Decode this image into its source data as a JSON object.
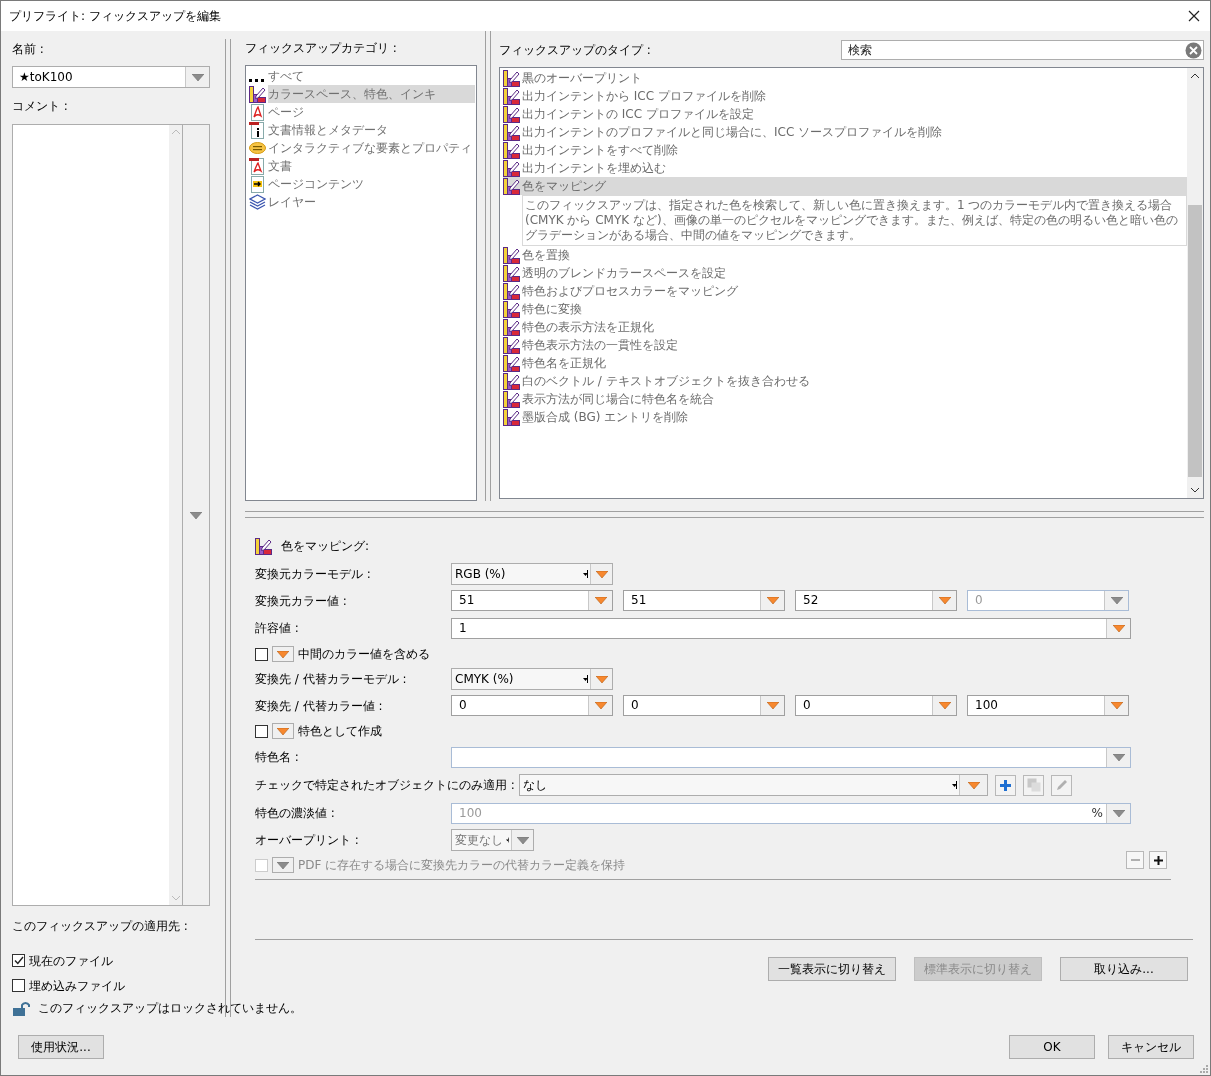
{
  "window": {
    "title": "プリフライト: フィックスアップを編集"
  },
  "name_field": {
    "label": "名前 :",
    "value": "★toK100"
  },
  "comment": {
    "label": "コメント :"
  },
  "apply_to": {
    "label": "このフィックスアップの適用先 :",
    "options": [
      {
        "label": "現在のファイル",
        "checked": true
      },
      {
        "label": "埋め込みファイル",
        "checked": false
      }
    ]
  },
  "lock_status": {
    "locked": false,
    "text": "このフィックスアップはロックされていません。"
  },
  "categories": {
    "label": "フィックスアップカテゴリ :",
    "items": [
      {
        "label": "すべて",
        "kind": "dots",
        "selected": false
      },
      {
        "label": "カラースペース、特色、インキ",
        "kind": "swatch",
        "selected": true
      },
      {
        "label": "ページ",
        "kind": "pdf",
        "selected": false
      },
      {
        "label": "文書情報とメタデータ",
        "kind": "info",
        "selected": false
      },
      {
        "label": "インタラクティブな要素とプロパティ",
        "kind": "comment",
        "selected": false
      },
      {
        "label": "文書",
        "kind": "doc",
        "selected": false
      },
      {
        "label": "ページコンテンツ",
        "kind": "content",
        "selected": false
      },
      {
        "label": "レイヤー",
        "kind": "layers",
        "selected": false
      }
    ]
  },
  "types": {
    "label": "フィックスアップのタイプ :",
    "search": {
      "placeholder": "検索"
    },
    "items": [
      {
        "label": "黒のオーバープリント",
        "selected": false
      },
      {
        "label": "出力インテントから ICC プロファイルを削除",
        "selected": false
      },
      {
        "label": "出力インテントの ICC プロファイルを設定",
        "selected": false
      },
      {
        "label": "出力インテントのプロファイルと同じ場合に、ICC ソースプロファイルを削除",
        "selected": false
      },
      {
        "label": "出力インテントをすべて削除",
        "selected": false
      },
      {
        "label": "出力インテントを埋め込む",
        "selected": false
      },
      {
        "label": "色をマッピング",
        "selected": true,
        "description": "このフィックスアップは、指定された色を検索して、新しい色に置き換えます。1 つのカラーモデル内で置き換える場合 (CMYK から CMYK など)、画像の単一のピクセルをマッピングできます。また、例えば、特定の色の明るい色と暗い色のグラデーションがある場合、中間の値をマッピングできます。"
      },
      {
        "label": "色を置換",
        "selected": false
      },
      {
        "label": "透明のブレンドカラースペースを設定",
        "selected": false
      },
      {
        "label": "特色およびプロセスカラーをマッピング",
        "selected": false
      },
      {
        "label": "特色に変換",
        "selected": false
      },
      {
        "label": "特色の表示方法を正規化",
        "selected": false
      },
      {
        "label": "特色表示方法の一貫性を設定",
        "selected": false
      },
      {
        "label": "特色名を正規化",
        "selected": false
      },
      {
        "label": "白のベクトル / テキストオブジェクトを抜き合わせる",
        "selected": false
      },
      {
        "label": "表示方法が同じ場合に特色名を統合",
        "selected": false
      },
      {
        "label": "墨版合成 (BG) エントリを削除",
        "selected": false
      }
    ]
  },
  "editor": {
    "title": "色をマッピング:",
    "remove_disabled": true,
    "rows": [
      {
        "kind": "select",
        "label": "変換元カラーモデル :",
        "value": "RGB (%)",
        "disabled": false
      },
      {
        "kind": "values",
        "label": "変換元カラー値 :",
        "fields": [
          {
            "value": "51",
            "disabled": false
          },
          {
            "value": "51",
            "disabled": false
          },
          {
            "value": "52",
            "disabled": false
          },
          {
            "value": "0",
            "disabled": true
          }
        ]
      },
      {
        "kind": "text",
        "label": "許容値 :",
        "value": "1",
        "disabled": false
      },
      {
        "kind": "checkbox",
        "label": "中間のカラー値を含める",
        "checked": false,
        "disabled": false
      },
      {
        "kind": "select",
        "label": "変換先 / 代替カラーモデル :",
        "value": "CMYK (%)",
        "disabled": false
      },
      {
        "kind": "values",
        "label": "変換先 / 代替カラー値 :",
        "fields": [
          {
            "value": "0",
            "disabled": false
          },
          {
            "value": "0",
            "disabled": false
          },
          {
            "value": "0",
            "disabled": false
          },
          {
            "value": "100",
            "disabled": false
          }
        ]
      },
      {
        "kind": "checkbox",
        "label": "特色として作成",
        "checked": false,
        "disabled": false
      },
      {
        "kind": "text",
        "label": "特色名 :",
        "disabled": true
      },
      {
        "kind": "select_tools",
        "label": "チェックで特定されたオブジェクトにのみ適用 :",
        "value": "なし",
        "tools": [
          {
            "kind": "add",
            "disabled": false
          },
          {
            "kind": "duplicate",
            "disabled": true
          },
          {
            "kind": "edit",
            "disabled": true
          }
        ]
      },
      {
        "kind": "text",
        "label": "特色の濃淡値 :",
        "value": "100",
        "unit": "%",
        "disabled": true
      },
      {
        "kind": "small_select",
        "label": "オーバープリント :",
        "value": "変更なし",
        "disabled": true
      },
      {
        "kind": "checkbox",
        "label": "PDF に存在する場合に変換先カラーの代替カラー定義を保持",
        "checked": false,
        "disabled": true
      }
    ]
  },
  "panel_buttons": [
    {
      "label": "一覧表示に切り替え",
      "disabled": false
    },
    {
      "label": "標準表示に切り替え",
      "disabled": true
    },
    {
      "label": "取り込み...",
      "disabled": false
    }
  ],
  "footer": {
    "usage_button": "使用状況...",
    "buttons": [
      "OK",
      "キャンセル"
    ]
  }
}
